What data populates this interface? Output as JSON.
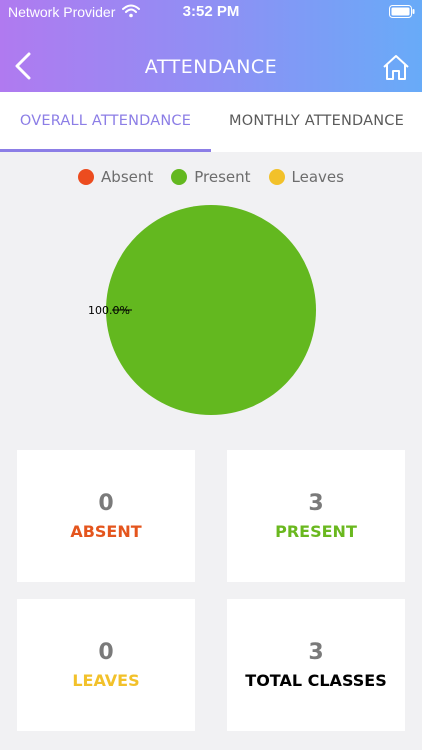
{
  "status_bar": {
    "carrier": "Network Provider",
    "time": "3:52 PM"
  },
  "header": {
    "title": "ATTENDANCE"
  },
  "tabs": [
    {
      "label": "OVERALL ATTENDANCE",
      "active": true
    },
    {
      "label": "MONTHLY ATTENDANCE",
      "active": false
    }
  ],
  "legend": [
    {
      "label": "Absent",
      "color": "#ec4c1f"
    },
    {
      "label": "Present",
      "color": "#63b81f"
    },
    {
      "label": "Leaves",
      "color": "#f2c12a"
    }
  ],
  "chart_data": {
    "type": "pie",
    "categories": [
      "Absent",
      "Present",
      "Leaves"
    ],
    "values": [
      0,
      3,
      0
    ],
    "colors": [
      "#ec4c1f",
      "#63b81f",
      "#f2c12a"
    ],
    "slice_labels": [
      "100.0%"
    ]
  },
  "cards": [
    {
      "value": "0",
      "label": "ABSENT",
      "color": "#e4551d"
    },
    {
      "value": "3",
      "label": "PRESENT",
      "color": "#6ab81f"
    },
    {
      "value": "0",
      "label": "LEAVES",
      "color": "#f2c12a"
    },
    {
      "value": "3",
      "label": "TOTAL CLASSES",
      "color": "#000000"
    }
  ]
}
